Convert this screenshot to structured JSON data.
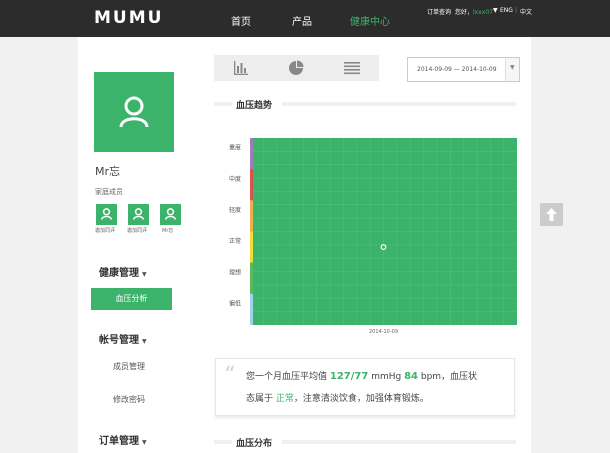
{
  "brand": {
    "logo": "MUMU",
    "accent": "#3bb36b"
  },
  "nav": {
    "items": [
      {
        "label": "首页",
        "active": false
      },
      {
        "label": "产品",
        "active": false
      },
      {
        "label": "健康中心",
        "active": true
      }
    ],
    "utility": {
      "order_query": "订单查询",
      "greeting": "您好，",
      "username": "lxxx07",
      "lang_en": "ENG",
      "sep": "|",
      "lang_cn": "中文"
    }
  },
  "sidebar": {
    "user_name": "Mr忘",
    "family_label": "家庭成员",
    "members": [
      {
        "label": "邀加同评"
      },
      {
        "label": "邀加同评"
      },
      {
        "label": "Mr忘"
      }
    ],
    "menus": [
      {
        "title": "健康管理",
        "caret": "▼"
      },
      {
        "title": "帐号管理",
        "caret": "▼"
      },
      {
        "title": "订单管理",
        "caret": "▼"
      }
    ],
    "active_item": "血压分析",
    "sub_items": [
      "成员管理",
      "修改密码"
    ]
  },
  "toolbar": {
    "view_icons": [
      "bar-chart-icon",
      "pie-chart-icon",
      "list-icon"
    ],
    "date_range": "2014-09-09 — 2014-10-09",
    "dropdown_caret": "▼"
  },
  "sections": {
    "trend_title": "血压趋势",
    "distribution_title": "血压分布"
  },
  "chart_data": {
    "type": "scatter",
    "title": "",
    "y_categories": [
      "重度",
      "中度",
      "轻度",
      "正常",
      "理想",
      "偏低"
    ],
    "y_band_colors": [
      "#a57ab8",
      "#d9534f",
      "#f0ad4e",
      "#f2dc3a",
      "#5cb85c",
      "#9fd3ea"
    ],
    "x_tick_labels": [
      "2014-10-09"
    ],
    "points": [
      {
        "x": "2014-10-09",
        "y": "正常"
      }
    ],
    "plot_color": "#3bb36b",
    "grid": true
  },
  "summary": {
    "line1_prefix": "您一个月血压平均值 ",
    "bp_value": "127/77",
    "bp_unit": " mmHg ",
    "pulse_value": "84",
    "pulse_unit": " bpm，血压状",
    "line2_prefix": "态属于 ",
    "status": "正常",
    "line2_suffix": "，注意清淡饮食，加强体育锻炼。"
  }
}
